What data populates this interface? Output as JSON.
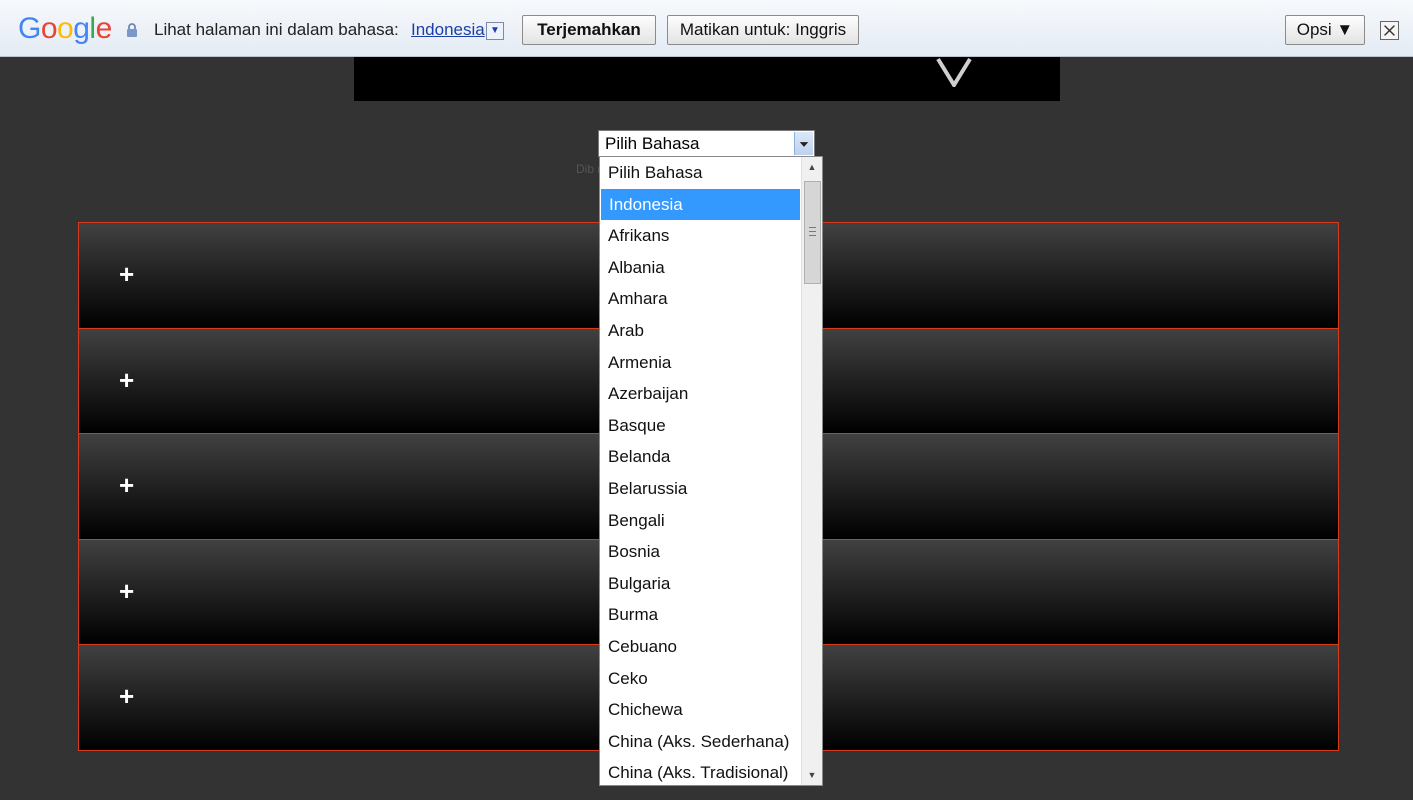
{
  "translate_bar": {
    "logo": "Google",
    "logo_colors": [
      "#4285f4",
      "#ea4335",
      "#fbbc05",
      "#4285f4",
      "#34a853",
      "#ea4335"
    ],
    "prompt": "Lihat halaman ini dalam bahasa:",
    "language_link": "Indonesia",
    "translate_button": "Terjemahkan",
    "never_button": "Matikan untuk: Inggris",
    "options_button": "Opsi ▼",
    "close_icon": "close-icon"
  },
  "language_select": {
    "value": "Pilih Bahasa",
    "powered_by": "Dib                                          m"
  },
  "accordion": {
    "items": [
      "+",
      "+",
      "+",
      "+",
      "+"
    ],
    "border_color": "#d63a1a"
  },
  "dropdown": {
    "selected": "Indonesia",
    "options": [
      "Pilih Bahasa",
      "Indonesia",
      "Afrikans",
      "Albania",
      "Amhara",
      "Arab",
      "Armenia",
      "Azerbaijan",
      "Basque",
      "Belanda",
      "Belarussia",
      "Bengali",
      "Bosnia",
      "Bulgaria",
      "Burma",
      "Cebuano",
      "Ceko",
      "Chichewa",
      "China (Aks. Sederhana)",
      "China (Aks. Tradisional)"
    ],
    "highlight_color": "#3399ff"
  }
}
